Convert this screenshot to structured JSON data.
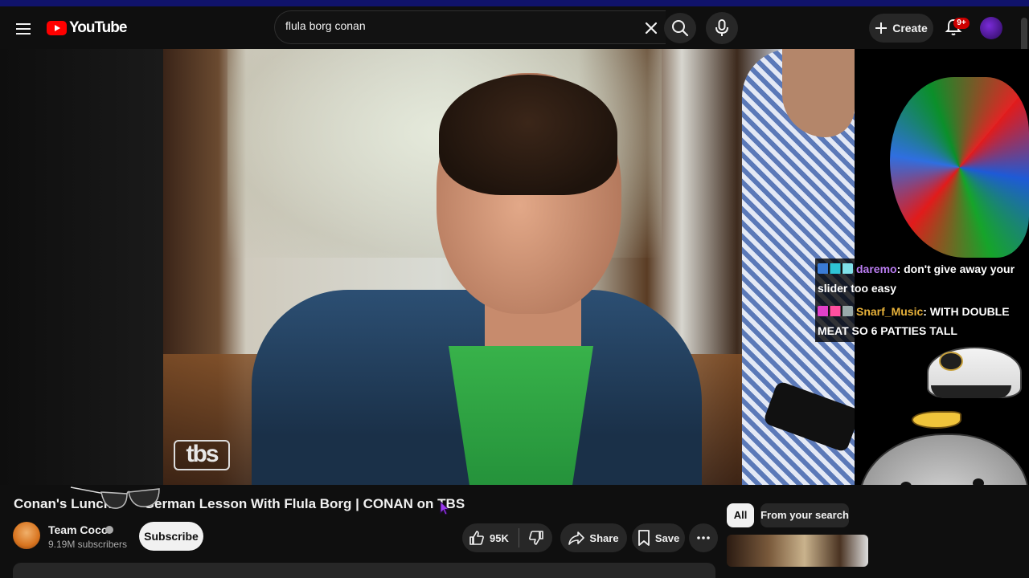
{
  "header": {
    "logo_text": "YouTube",
    "search_value": "flula borg conan",
    "create_label": "Create",
    "notification_count": "9+"
  },
  "player": {
    "watermark": "tbs",
    "chat": [
      {
        "user": "daremo",
        "message": ": don't give away your slider too easy"
      },
      {
        "user": "Snarf_Music",
        "message": ": WITH DOUBLE MEAT SO 6 PATTIES TALL"
      }
    ]
  },
  "video": {
    "title": "Conan's Lunch … German Lesson With Flula Borg | CONAN on TBS",
    "title_visible_left": "Conan's Luncht",
    "title_visible_right": "German Lesson With Flula Borg | CONAN on TBS"
  },
  "channel": {
    "name": "Team Coco",
    "subscribers": "9.19M subscribers",
    "subscribe_label": "Subscribe"
  },
  "actions": {
    "like_count": "95K",
    "share_label": "Share",
    "save_label": "Save"
  },
  "chips": {
    "all": "All",
    "from_search": "From your search"
  },
  "colors": {
    "brand_red": "#ff0000",
    "background": "#0f0f0f",
    "button_bg": "#272727",
    "chat_user1": "#b97cf0",
    "chat_user2": "#e8b23a"
  }
}
